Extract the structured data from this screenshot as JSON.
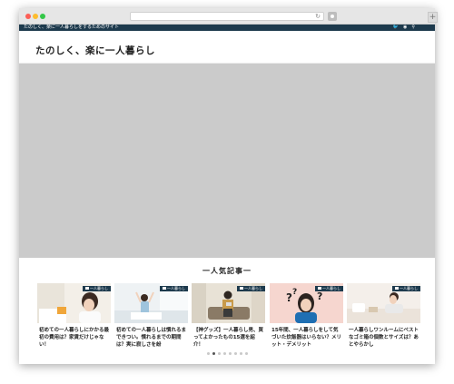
{
  "site": {
    "tagline": "たのしく、楽に一人暮らしをするためのサイト",
    "title": "たのしく、楽に一人暮らし"
  },
  "topbar_icons": [
    "twitter-icon",
    "rss-icon",
    "search-icon"
  ],
  "popular": {
    "heading": "一人気記事一",
    "cards": [
      {
        "badge": "一人暮らし",
        "title": "初めての一人暮らしにかかる最初の費用は？家賃だけじゃない！"
      },
      {
        "badge": "一人暮らし",
        "title": "初めての一人暮らしは慣れるまできつい。慣れるまでの期間は？実に寂しさを紛"
      },
      {
        "badge": "一人暮らし",
        "title": "【神グッズ】一人暮らし男、買ってよかったもの15選を紹介！"
      },
      {
        "badge": "一人暮らし",
        "title": "15年間、一人暮らしをして気づいた炊飯器はいらない？メリット・デメリット"
      },
      {
        "badge": "一人暮らし",
        "title": "一人暮らしワンルームにベストなゴミ箱の個数とサイズは？あとやらかし"
      }
    ],
    "pagination_count": 8,
    "pagination_active": 2
  },
  "colors": {
    "topbar": "#1d3a4d",
    "hero_placeholder": "#cbcbcb"
  }
}
